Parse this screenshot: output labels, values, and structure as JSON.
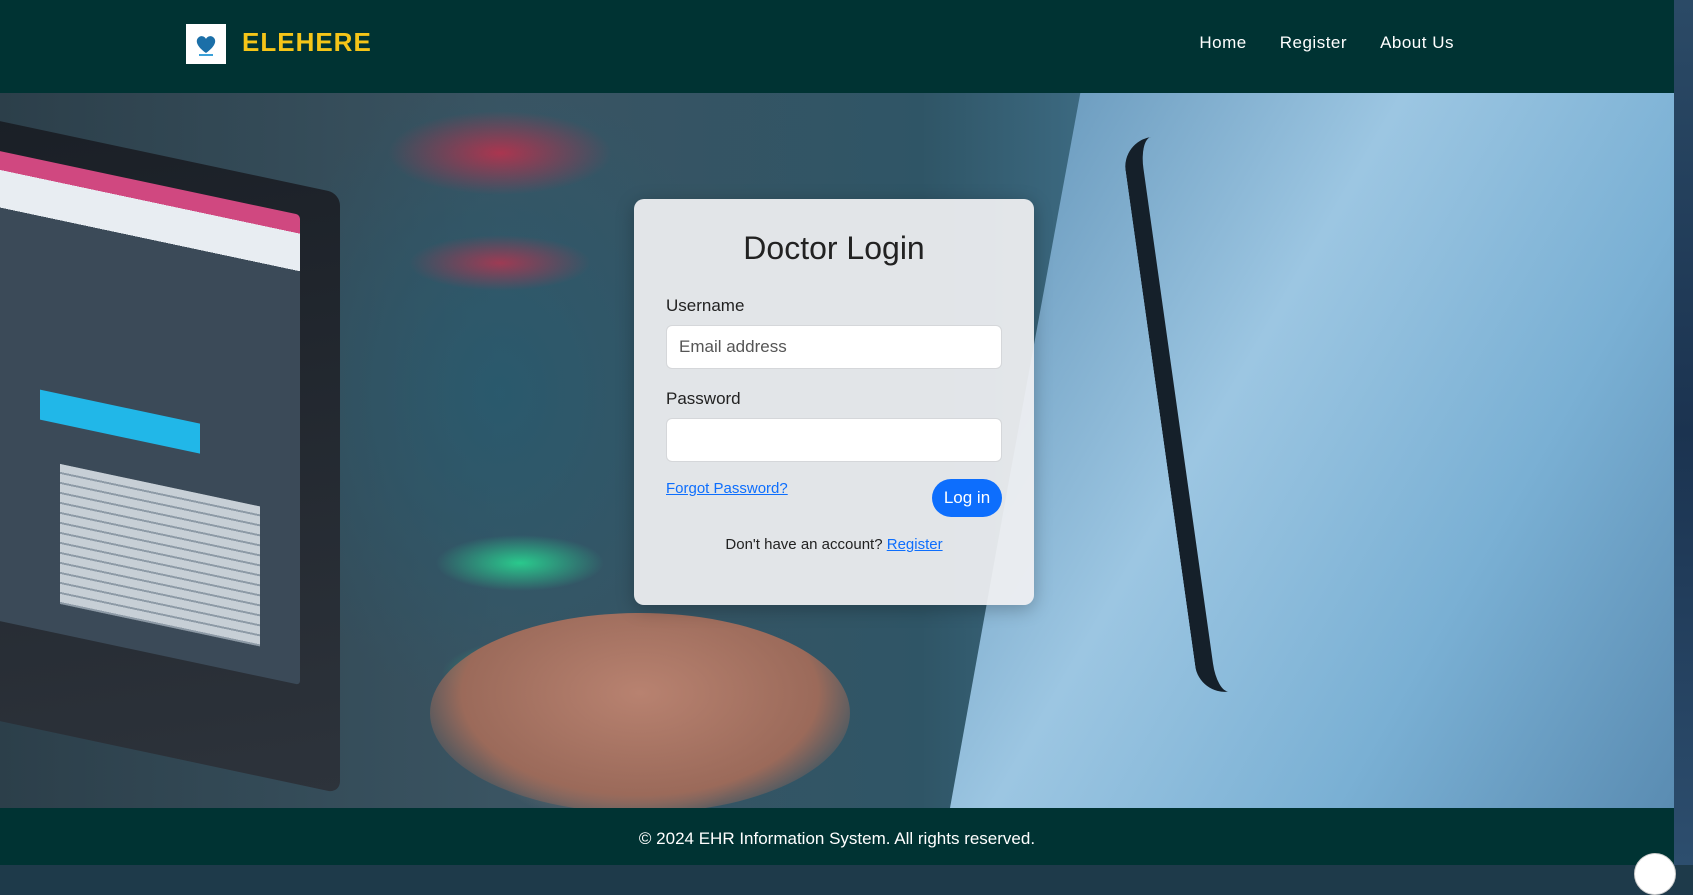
{
  "header": {
    "brand": "ELEHERE",
    "nav": [
      "Home",
      "Register",
      "About Us"
    ]
  },
  "login": {
    "title": "Doctor Login",
    "username_label": "Username",
    "username_placeholder": "Email address",
    "password_label": "Password",
    "forgot_link": "Forgot Password?",
    "login_button": "Log in",
    "signup_text": "Don't have an account?",
    "signup_link": "Register"
  },
  "footer": {
    "text": "© 2024 EHR Information System. All rights reserved."
  },
  "colors": {
    "header_bg": "#003333",
    "brand": "#f5c518",
    "primary": "#0d6efd"
  },
  "icons": {
    "logo": "heart-logo-icon"
  }
}
